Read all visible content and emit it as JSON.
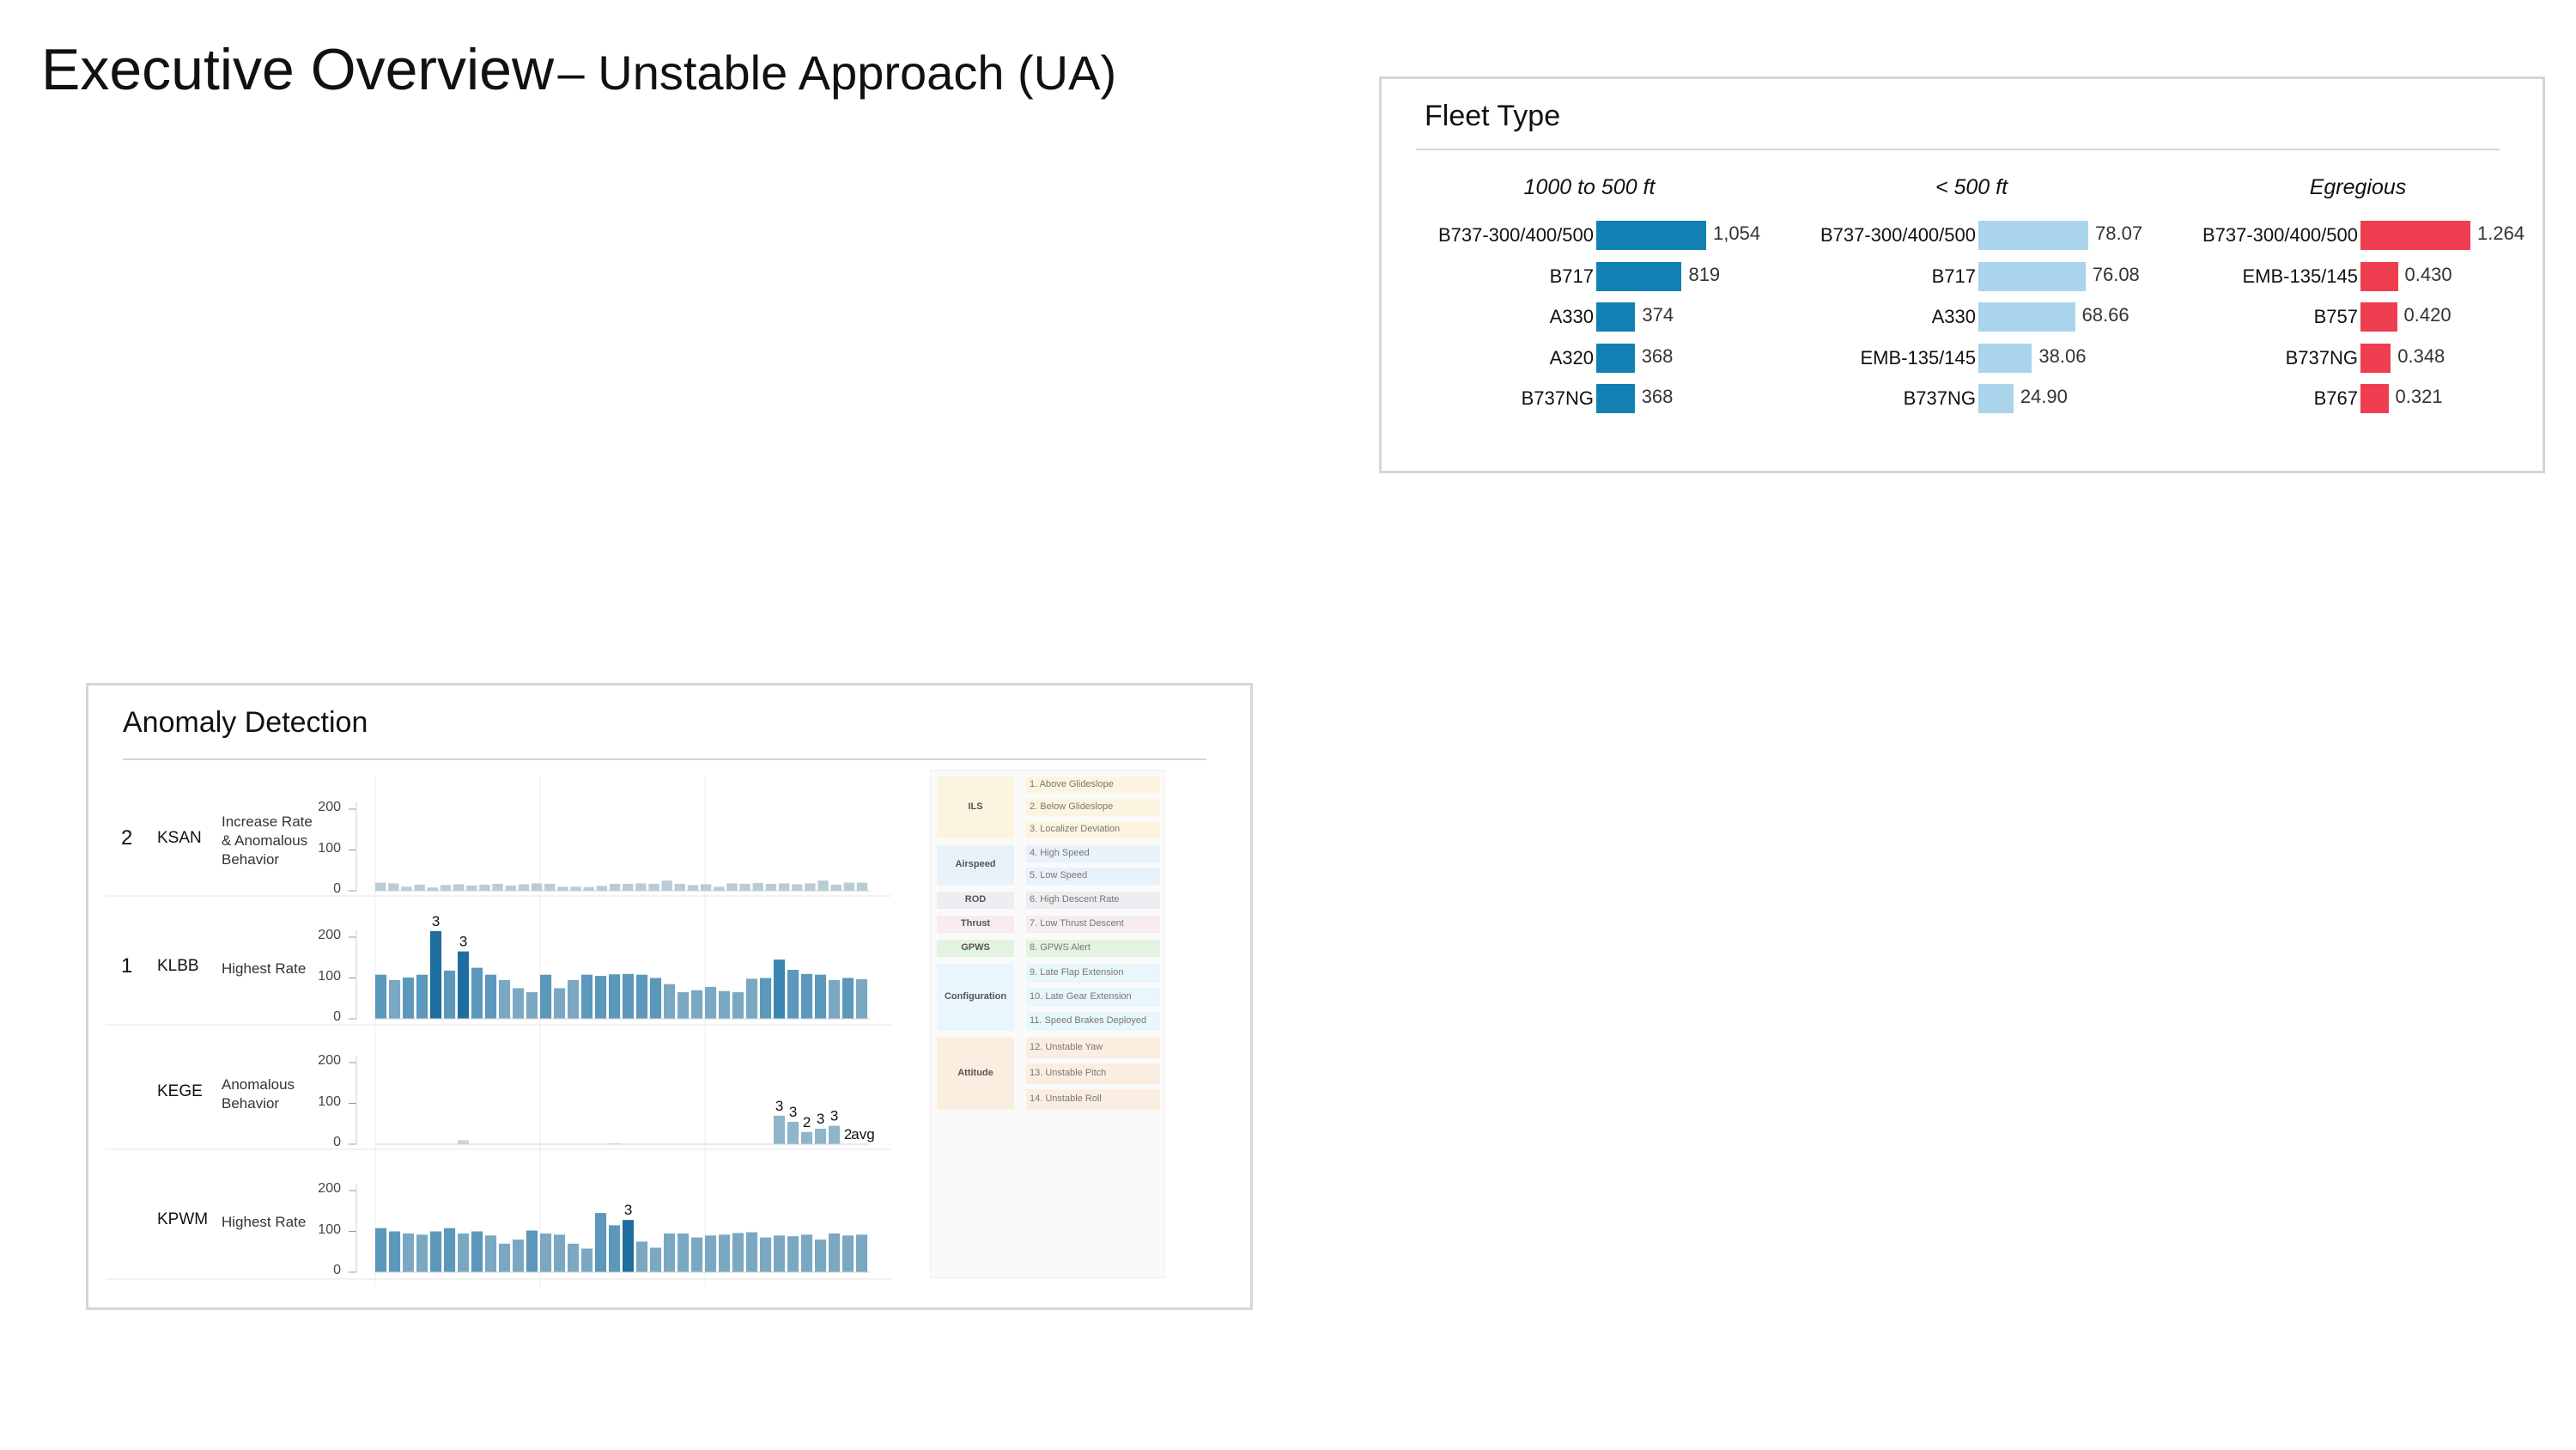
{
  "header": {
    "title_main": "Executive Overview",
    "title_sub": "– Unstable Approach (UA)"
  },
  "fleet": {
    "title": "Fleet Type",
    "columns": [
      {
        "title": "1000 to 500 ft",
        "color": "#1380b3",
        "max": 1054,
        "rows": [
          {
            "label": "B737-300/400/500",
            "value": 1054,
            "text": "1,054"
          },
          {
            "label": "B717",
            "value": 819,
            "text": "819"
          },
          {
            "label": "A330",
            "value": 374,
            "text": "374"
          },
          {
            "label": "A320",
            "value": 368,
            "text": "368"
          },
          {
            "label": "B737NG",
            "value": 368,
            "text": "368"
          }
        ]
      },
      {
        "title": "< 500 ft",
        "color": "#a9d4ec",
        "max": 78.07,
        "rows": [
          {
            "label": "B737-300/400/500",
            "value": 78.07,
            "text": "78.07"
          },
          {
            "label": "B717",
            "value": 76.08,
            "text": "76.08"
          },
          {
            "label": "A330",
            "value": 68.66,
            "text": "68.66"
          },
          {
            "label": "EMB-135/145",
            "value": 38.06,
            "text": "38.06"
          },
          {
            "label": "B737NG",
            "value": 24.9,
            "text": "24.90"
          }
        ]
      },
      {
        "title": "Egregious",
        "color": "#ef3e4f",
        "max": 1.264,
        "rows": [
          {
            "label": "B737-300/400/500",
            "value": 1.264,
            "text": "1.264"
          },
          {
            "label": "EMB-135/145",
            "value": 0.43,
            "text": "0.430"
          },
          {
            "label": "B757",
            "value": 0.42,
            "text": "0.420"
          },
          {
            "label": "B737NG",
            "value": 0.348,
            "text": "0.348"
          },
          {
            "label": "B767",
            "value": 0.321,
            "text": "0.321"
          }
        ]
      }
    ]
  },
  "anomaly": {
    "title": "Anomaly Detection",
    "y_ticks": [
      "200",
      "100",
      "0"
    ],
    "ylim": [
      0,
      200
    ],
    "avg_label": "avg",
    "rows": [
      {
        "rank": "2",
        "airport": "KSAN",
        "description": [
          "Increase Rate",
          "& Anomalous",
          "Behavior"
        ],
        "values": [
          20,
          18,
          10,
          15,
          8,
          14,
          16,
          13,
          15,
          17,
          13,
          16,
          18,
          17,
          10,
          10,
          9,
          12,
          17,
          17,
          18,
          17,
          25,
          17,
          14,
          16,
          10,
          18,
          17,
          19,
          17,
          18,
          16,
          18,
          25,
          15,
          20,
          20
        ],
        "highlights": [],
        "labels": []
      },
      {
        "rank": "1",
        "airport": "KLBB",
        "description": [
          "Highest Rate"
        ],
        "values": [
          108,
          95,
          101,
          108,
          215,
          118,
          165,
          125,
          108,
          95,
          75,
          65,
          108,
          75,
          95,
          108,
          105,
          109,
          110,
          108,
          100,
          85,
          65,
          70,
          78,
          68,
          65,
          98,
          100,
          145,
          120,
          110,
          108,
          95,
          100,
          97
        ],
        "highlights": [
          4,
          6
        ],
        "labels": [
          {
            "i": 4,
            "t": "3"
          },
          {
            "i": 6,
            "t": "3"
          }
        ]
      },
      {
        "rank": "",
        "airport": "KEGE",
        "description": [
          "Anomalous",
          "Behavior"
        ],
        "values": [
          0,
          0,
          0,
          0,
          0,
          1,
          10,
          1,
          0,
          0,
          0,
          0,
          0,
          0,
          0,
          0,
          1,
          2,
          0,
          0,
          0,
          1,
          0,
          0,
          0,
          0,
          0,
          0,
          1,
          70,
          55,
          30,
          38,
          45,
          0,
          0
        ],
        "highlights": [],
        "labels": [
          {
            "i": 29,
            "t": "3"
          },
          {
            "i": 30,
            "t": "3"
          },
          {
            "i": 31,
            "t": "2"
          },
          {
            "i": 32,
            "t": "3"
          },
          {
            "i": 33,
            "t": "3"
          },
          {
            "i": 34,
            "t": "2"
          }
        ]
      },
      {
        "rank": "",
        "airport": "KPWM",
        "description": [
          "Highest Rate"
        ],
        "values": [
          108,
          100,
          95,
          92,
          100,
          108,
          95,
          100,
          90,
          70,
          80,
          102,
          95,
          92,
          70,
          58,
          145,
          115,
          128,
          75,
          60,
          95,
          95,
          85,
          90,
          92,
          96,
          98,
          85,
          90,
          88,
          92,
          80,
          95,
          90,
          92
        ],
        "highlights": [
          18
        ],
        "labels": [
          {
            "i": 18,
            "t": "3"
          }
        ]
      }
    ],
    "legend": [
      {
        "category": "ILS",
        "color": "#fdf4df",
        "items": [
          "1. Above Glideslope",
          "2. Below Glideslope",
          "3. Localizer Deviation"
        ]
      },
      {
        "category": "Airspeed",
        "color": "#e9f1fb",
        "items": [
          "4. High Speed",
          "5. Low Speed"
        ]
      },
      {
        "category": "ROD",
        "color": "#eeeef2",
        "items": [
          "6. High Descent Rate"
        ]
      },
      {
        "category": "Thrust",
        "color": "#f7ecee",
        "items": [
          "7. Low Thrust Descent"
        ]
      },
      {
        "category": "GPWS",
        "color": "#e4f3e1",
        "items": [
          "8. GPWS Alert"
        ]
      },
      {
        "category": "Configuration",
        "color": "#e9f6fb",
        "items": [
          "9. Late Flap Extension",
          "10. Late Gear Extension",
          "11. Speed Brakes Deployed"
        ]
      },
      {
        "category": "Attitude",
        "color": "#fbeee0",
        "items": [
          "12. Unstable Yaw",
          "13. Unstable Pitch",
          "14. Unstable Roll"
        ]
      }
    ]
  },
  "chart_data": [
    {
      "type": "bar",
      "title": "Fleet Type",
      "subtitle": "1000 to 500 ft",
      "categories": [
        "B737-300/400/500",
        "B717",
        "A330",
        "A320",
        "B737NG"
      ],
      "values": [
        1054,
        819,
        374,
        368,
        368
      ]
    },
    {
      "type": "bar",
      "title": "Fleet Type",
      "subtitle": "< 500 ft",
      "categories": [
        "B737-300/400/500",
        "B717",
        "A330",
        "EMB-135/145",
        "B737NG"
      ],
      "values": [
        78.07,
        76.08,
        68.66,
        38.06,
        24.9
      ]
    },
    {
      "type": "bar",
      "title": "Fleet Type",
      "subtitle": "Egregious",
      "categories": [
        "B737-300/400/500",
        "EMB-135/145",
        "B757",
        "B737NG",
        "B767"
      ],
      "values": [
        1.264,
        0.43,
        0.42,
        0.348,
        0.321
      ]
    },
    {
      "type": "bar",
      "title": "Anomaly Detection",
      "ylim": [
        0,
        200
      ],
      "grid": false,
      "series": [
        {
          "name": "KSAN",
          "values": [
            20,
            18,
            10,
            15,
            8,
            14,
            16,
            13,
            15,
            17,
            13,
            16,
            18,
            17,
            10,
            10,
            9,
            12,
            17,
            17,
            18,
            17,
            25,
            17,
            14,
            16,
            10,
            18,
            17,
            19,
            17,
            18,
            16,
            18,
            25,
            15,
            20,
            20
          ]
        },
        {
          "name": "KLBB",
          "values": [
            108,
            95,
            101,
            108,
            215,
            118,
            165,
            125,
            108,
            95,
            75,
            65,
            108,
            75,
            95,
            108,
            105,
            109,
            110,
            108,
            100,
            85,
            65,
            70,
            78,
            68,
            65,
            98,
            100,
            145,
            120,
            110,
            108,
            95,
            100,
            97
          ]
        },
        {
          "name": "KEGE",
          "values": [
            0,
            0,
            0,
            0,
            0,
            1,
            10,
            1,
            0,
            0,
            0,
            0,
            0,
            0,
            0,
            0,
            1,
            2,
            0,
            0,
            0,
            1,
            0,
            0,
            0,
            0,
            0,
            0,
            1,
            70,
            55,
            30,
            38,
            45,
            0,
            0
          ]
        },
        {
          "name": "KPWM",
          "values": [
            108,
            100,
            95,
            92,
            100,
            108,
            95,
            100,
            90,
            70,
            80,
            102,
            95,
            92,
            70,
            58,
            145,
            115,
            128,
            75,
            60,
            95,
            95,
            85,
            90,
            92,
            96,
            98,
            85,
            90,
            88,
            92,
            80,
            95,
            90,
            92
          ]
        }
      ]
    }
  ]
}
